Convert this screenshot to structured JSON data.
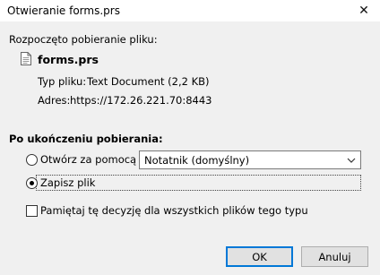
{
  "window": {
    "title": "Otwieranie forms.prs",
    "close_glyph": "✕"
  },
  "download": {
    "intro": "Rozpoczęto pobieranie pliku:",
    "filename": "forms.prs",
    "type_label": "Typ pliku:",
    "type_value": "Text Document (2,2 KB)",
    "address_label": "Adres:",
    "address_value": "https://172.26.221.70:8443"
  },
  "after_download": {
    "heading": "Po ukończeniu pobierania:",
    "open_with_label": "Otwórz za pomocą",
    "open_with_selected": "Notatnik (domyślny)",
    "save_file_label": "Zapisz plik",
    "selected_option": "save_file",
    "remember_label": "Pamiętaj tę decyzję dla wszystkich plików tego typu",
    "remember_checked": false
  },
  "buttons": {
    "ok": "OK",
    "cancel": "Anuluj"
  },
  "icons": {
    "file": "document-icon",
    "dropdown": "chevron-down-icon",
    "close": "close-icon"
  },
  "colors": {
    "background": "#f0f0f0",
    "default_button_border": "#0078d7"
  }
}
